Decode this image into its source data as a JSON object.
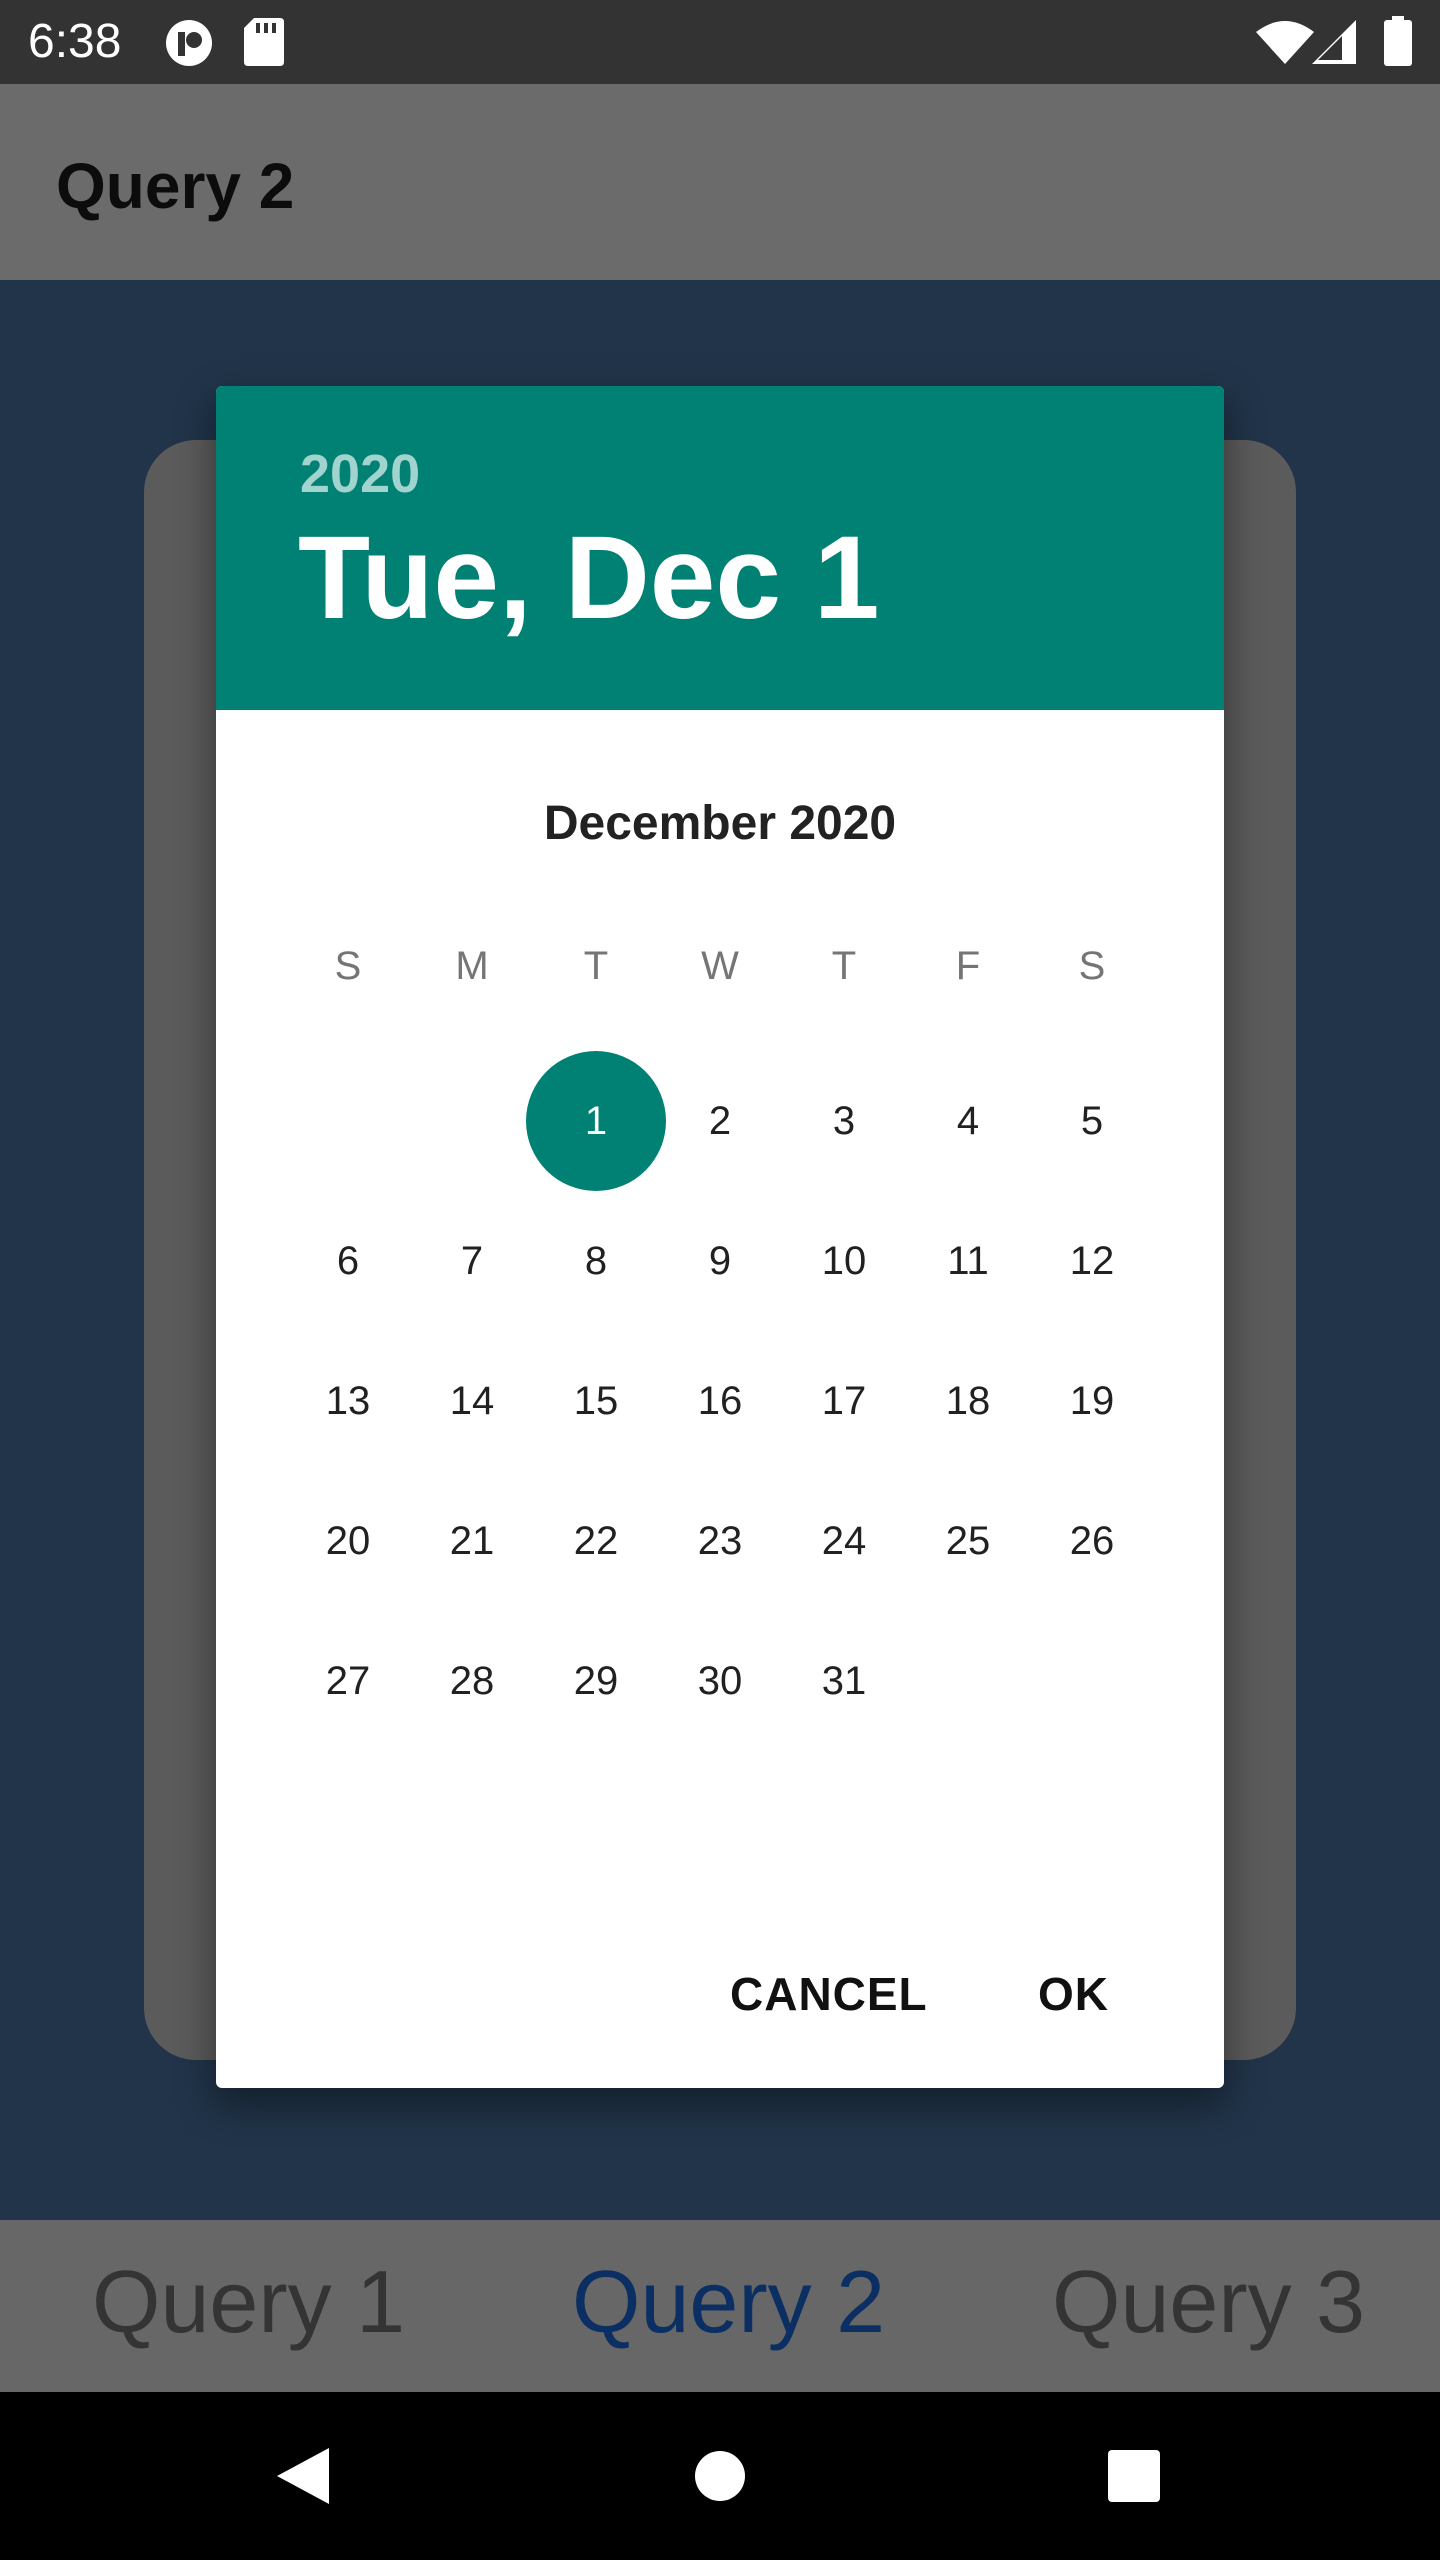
{
  "status_bar": {
    "time": "6:38",
    "left_icons": [
      "circle-app-icon",
      "sd-card-icon"
    ],
    "right_icons": [
      "wifi-icon",
      "cell-signal-icon",
      "battery-icon"
    ]
  },
  "app_bar": {
    "title": "Query 2"
  },
  "bottom_tabs": [
    {
      "label": "Query 1",
      "active": false
    },
    {
      "label": "Query 2",
      "active": true
    },
    {
      "label": "Query 3",
      "active": false
    }
  ],
  "date_picker": {
    "header_year": "2020",
    "header_date": "Tue, Dec 1",
    "month_label": "December 2020",
    "weekdays": [
      "S",
      "M",
      "T",
      "W",
      "T",
      "F",
      "S"
    ],
    "first_weekday_index": 2,
    "days_in_month": 31,
    "selected_day": "1",
    "cancel_label": "CANCEL",
    "ok_label": "OK",
    "accent_color": "#018174"
  },
  "nav_bar": {
    "buttons": [
      "back-icon",
      "home-icon",
      "recents-icon"
    ]
  }
}
